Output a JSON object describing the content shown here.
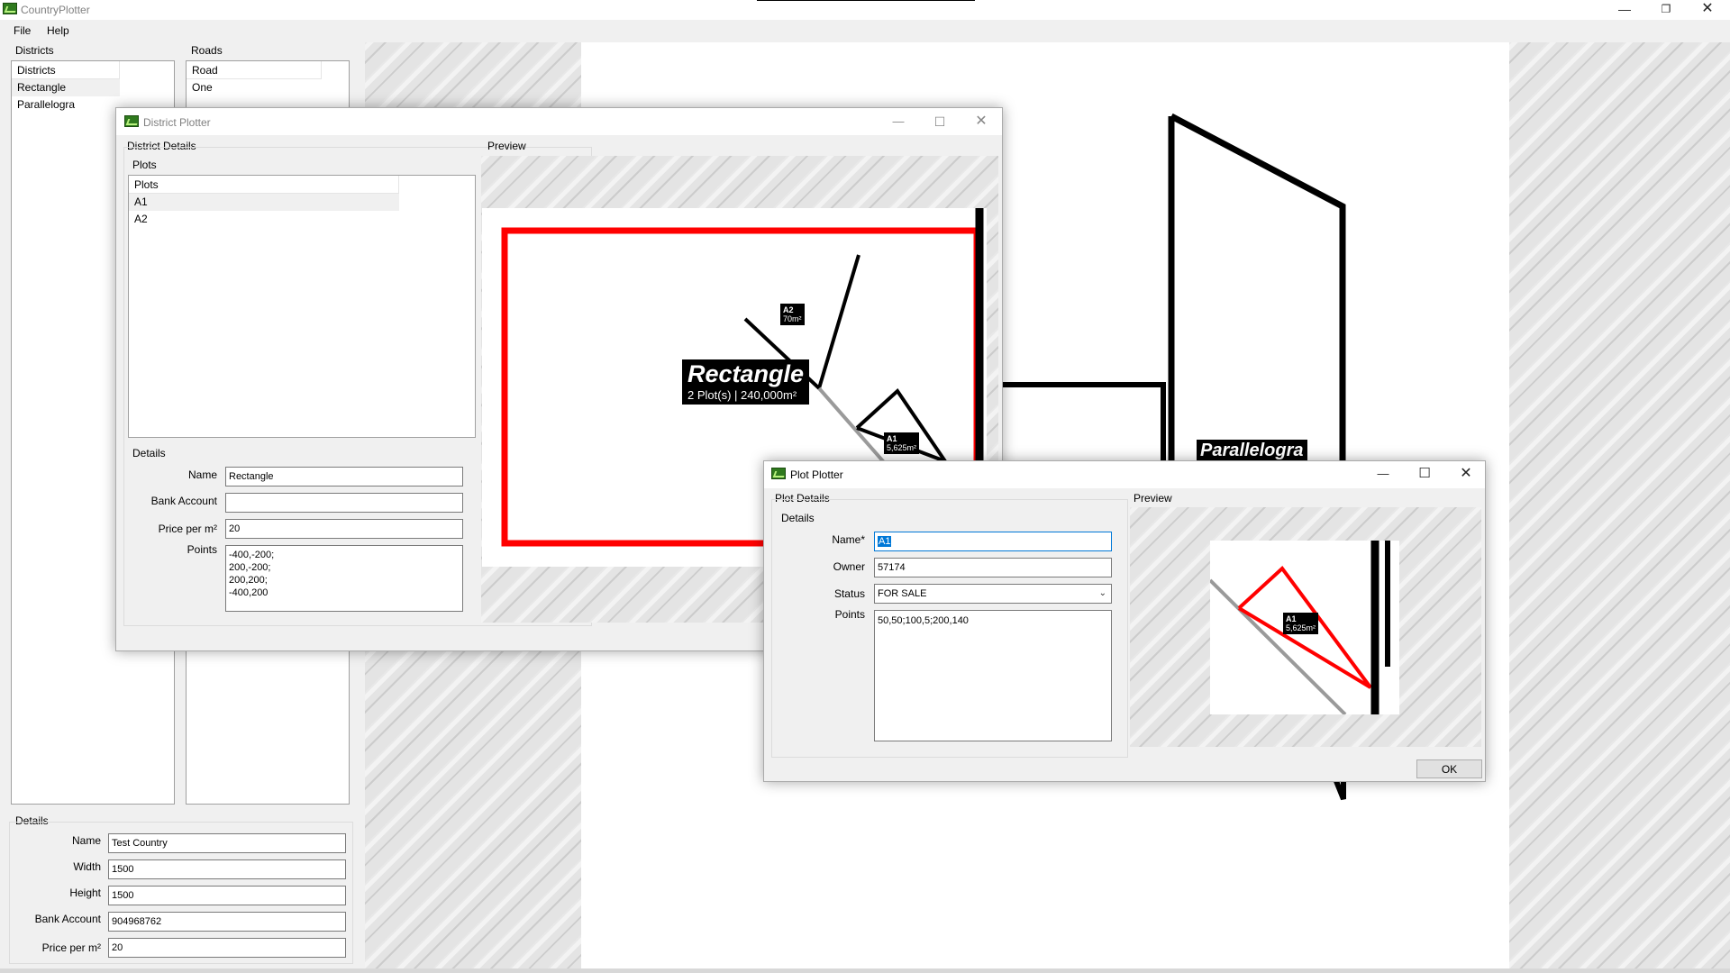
{
  "app": {
    "title": "CountryPlotter",
    "menu": [
      "File",
      "Help"
    ]
  },
  "districts": {
    "group_label": "Districts",
    "header": "Districts",
    "items": [
      "Rectangle",
      "Parallelogra"
    ]
  },
  "roads": {
    "group_label": "Roads",
    "header": "Road",
    "items": [
      "One"
    ]
  },
  "country_details": {
    "group_label": "Details",
    "name_label": "Name",
    "name_value": "Test Country",
    "width_label": "Width",
    "width_value": "1500",
    "height_label": "Height",
    "height_value": "1500",
    "bank_label": "Bank Account",
    "bank_value": "904968762",
    "price_label": "Price per m²",
    "price_value": "20"
  },
  "main_map": {
    "district_label": "Parallelogra"
  },
  "district_window": {
    "title": "District Plotter",
    "details_group": "District Details",
    "plots_group": "Plots",
    "plots_header": "Plots",
    "plots": [
      "A1",
      "A2"
    ],
    "details_label": "Details",
    "name_label": "Name",
    "name_value": "Rectangle",
    "bank_label": "Bank Account",
    "bank_value": "",
    "price_label": "Price per m²",
    "price_value": "20",
    "points_label": "Points",
    "points_lines": [
      "-400,-200;",
      "200,-200;",
      "200,200;",
      "-400,200"
    ],
    "preview_label": "Preview",
    "preview": {
      "district_name": "Rectangle",
      "district_info": "2 Plot(s) | 240,000m²",
      "plot_a2_name": "A2",
      "plot_a2_area": "70m²",
      "plot_a1_name": "A1",
      "plot_a1_area": "5,625m²"
    }
  },
  "plot_window": {
    "title": "Plot Plotter",
    "details_group": "Plot Details",
    "details_label": "Details",
    "name_label": "Name*",
    "name_value": "A1",
    "owner_label": "Owner",
    "owner_value": "57174",
    "status_label": "Status",
    "status_value": "FOR SALE",
    "points_label": "Points",
    "points_value": "50,50;100,5;200,140",
    "preview_label": "Preview",
    "preview": {
      "plot_name": "A1",
      "plot_area": "5,625m²"
    },
    "ok_label": "OK"
  },
  "colors": {
    "accent_red": "#ff0000",
    "selection_blue": "#0078d7",
    "icon_green": "#2f7a1e"
  }
}
